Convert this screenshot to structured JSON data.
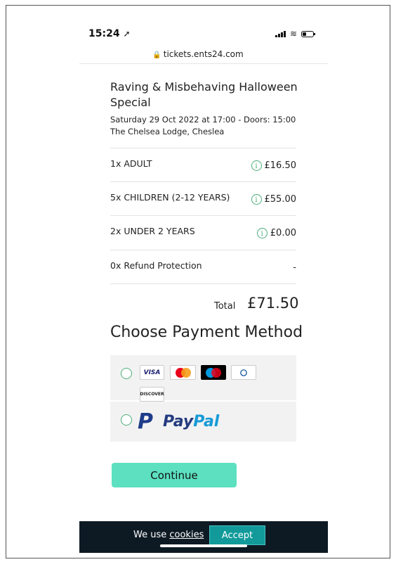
{
  "status_bar": {
    "time": "15:24",
    "location_icon": "location-arrow-icon"
  },
  "browser": {
    "url": "tickets.ents24.com"
  },
  "event": {
    "title": "Raving & Misbehaving Halloween Special",
    "date": "Saturday 29 Oct 2022 at 17:00 - Doors: 15:00",
    "venue": "The Chelsea Lodge, Cheslea"
  },
  "tickets": [
    {
      "label": "1x ADULT",
      "price": "£16.50",
      "has_info": true
    },
    {
      "label": "5x CHILDREN (2-12 YEARS)",
      "price": "£55.00",
      "has_info": true
    },
    {
      "label": "2x UNDER 2 YEARS",
      "price": "£0.00",
      "has_info": true
    },
    {
      "label": "0x Refund Protection",
      "price": "-",
      "has_info": false
    }
  ],
  "total": {
    "label": "Total",
    "value": "£71.50"
  },
  "payment": {
    "heading": "Choose Payment Method",
    "card_logos": [
      "VISA",
      "Mastercard",
      "Maestro",
      "Diners Club",
      "DISCOVER"
    ],
    "paypal": {
      "pay": "Pay",
      "pal": "Pal"
    }
  },
  "continue_label": "Continue",
  "cookie": {
    "text": "We use ",
    "link": "cookies",
    "accept": "Accept"
  },
  "colors": {
    "accent": "#5ce0c0",
    "radio": "#4cae7a",
    "cookie_bg": "#0d1a24",
    "accept_bg": "#129a9a"
  }
}
